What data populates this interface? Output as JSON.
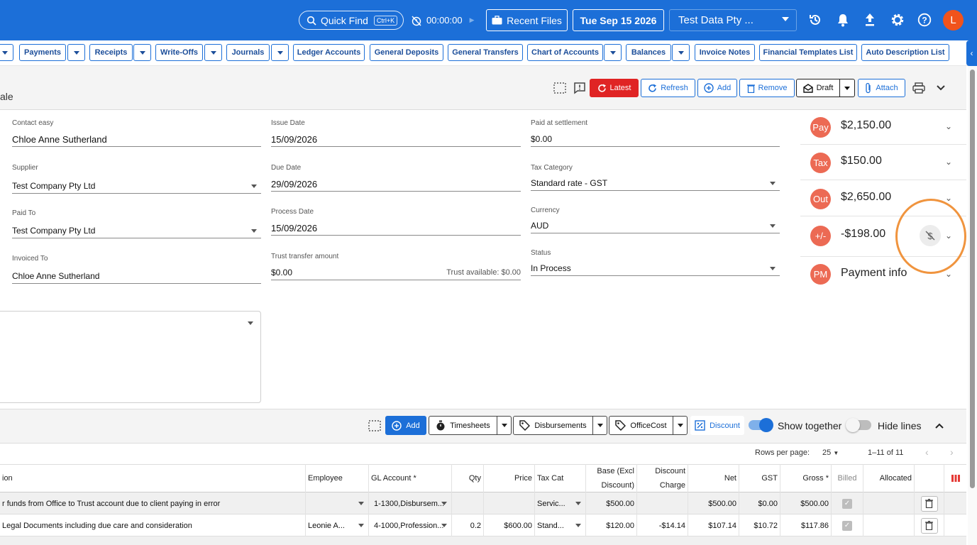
{
  "topbar": {
    "quick_find": "Quick Find",
    "quick_find_shortcut": "Ctrl+K",
    "timer": "00:00:00",
    "recent_files": "Recent Files",
    "date": "Tue Sep 15 2026",
    "organisation": "Test Data Pty ...",
    "avatar_letter": "L",
    "brand_color": "#1c6fd8"
  },
  "nav": {
    "items": [
      "Payments",
      "Receipts",
      "Write-Offs",
      "Journals",
      "Ledger Accounts",
      "General Deposits",
      "General Transfers",
      "Chart of Accounts",
      "Balances",
      "Invoice Notes",
      "Financial Templates List",
      "Auto Description List"
    ]
  },
  "header": {
    "title_fragment": "ale",
    "latest": "Latest",
    "refresh": "Refresh",
    "add": "Add",
    "remove": "Remove",
    "draft": "Draft",
    "attach": "Attach"
  },
  "form": {
    "contact": {
      "label": "Contact easy",
      "value": "Chloe Anne Sutherland"
    },
    "supplier": {
      "label": "Supplier",
      "value": "Test Company Pty Ltd"
    },
    "paid_to": {
      "label": "Paid To",
      "value": "Test Company Pty Ltd"
    },
    "invoiced_to": {
      "label": "Invoiced To",
      "value": "Chloe Anne Sutherland"
    },
    "issue_date": {
      "label": "Issue Date",
      "value": "15/09/2026"
    },
    "due_date": {
      "label": "Due Date",
      "value": "29/09/2026"
    },
    "process_date": {
      "label": "Process Date",
      "value": "15/09/2026"
    },
    "trust_transfer": {
      "label": "Trust transfer amount",
      "value": "$0.00",
      "trust_available": "Trust available: $0.00"
    },
    "paid_at_settlement": {
      "label": "Paid at settlement",
      "value": "$0.00"
    },
    "tax_category": {
      "label": "Tax Category",
      "value": "Standard rate - GST"
    },
    "currency": {
      "label": "Currency",
      "value": "AUD"
    },
    "status": {
      "label": "Status",
      "value": "In Process"
    }
  },
  "summary": [
    {
      "badge": "Pay",
      "amount": "$2,150.00"
    },
    {
      "badge": "Tax",
      "amount": "$150.00"
    },
    {
      "badge": "Out",
      "amount": "$2,650.00"
    },
    {
      "badge": "+/-",
      "amount": "-$198.00"
    },
    {
      "badge": "PM",
      "amount": "Payment info"
    }
  ],
  "lines_toolbar": {
    "add": "Add",
    "timesheets": "Timesheets",
    "disbursements": "Disbursements",
    "officecost": "OfficeCost",
    "discount": "Discount",
    "show_together": "Show together",
    "hide_lines": "Hide lines",
    "show_together_on": true,
    "hide_lines_on": false
  },
  "pager": {
    "rows_per_page_label": "Rows per page:",
    "rows_per_page": "25",
    "range": "1–11 of 11"
  },
  "table": {
    "headers": {
      "description": "ion",
      "employee": "Employee",
      "gl_account": "GL Account *",
      "qty": "Qty",
      "price": "Price",
      "tax_cat": "Tax Cat",
      "base_1": "Base (Excl",
      "base_2": "Discount)",
      "disc_1": "Discount",
      "disc_2": "Charge",
      "net": "Net",
      "gst": "GST",
      "gross": "Gross *",
      "billed": "Billed",
      "allocated": "Allocated"
    },
    "rows": [
      {
        "description": "r funds from Office to Trust account due to client paying in error",
        "employee": "",
        "gl_account": "1-1300,Disbursem...",
        "qty": "",
        "price": "",
        "tax_cat": "Servic...",
        "base": "$500.00",
        "discount": "",
        "net": "$500.00",
        "gst": "$0.00",
        "gross": "$500.00"
      },
      {
        "description": "Legal Documents including due care and consideration",
        "employee": "Leonie A...",
        "gl_account": "4-1000,Profession...",
        "qty": "0.2",
        "price": "$600.00",
        "tax_cat": "Stand...",
        "base": "$120.00",
        "discount": "-$14.14",
        "net": "$107.14",
        "gst": "$10.72",
        "gross": "$117.86"
      }
    ]
  }
}
